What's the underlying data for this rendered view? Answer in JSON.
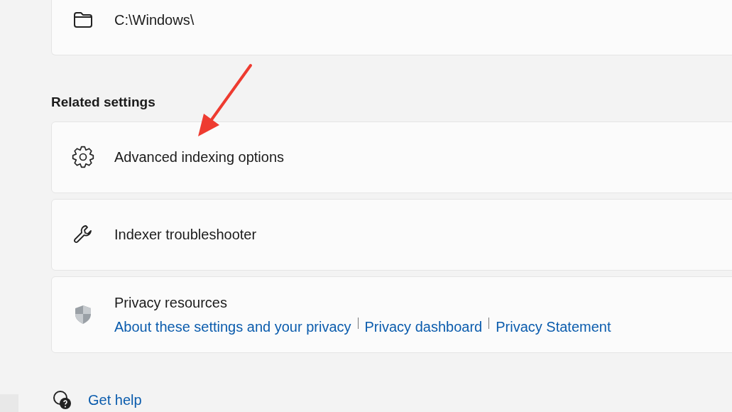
{
  "folder_card": {
    "path": "C:\\Windows\\"
  },
  "related_settings": {
    "heading": "Related settings",
    "items": [
      {
        "kind": "gear",
        "label": "Advanced indexing options"
      },
      {
        "kind": "wrench",
        "label": "Indexer troubleshooter"
      }
    ]
  },
  "privacy": {
    "title": "Privacy resources",
    "links": [
      "About these settings and your privacy",
      "Privacy dashboard",
      "Privacy Statement"
    ]
  },
  "get_help": {
    "label": "Get help"
  }
}
